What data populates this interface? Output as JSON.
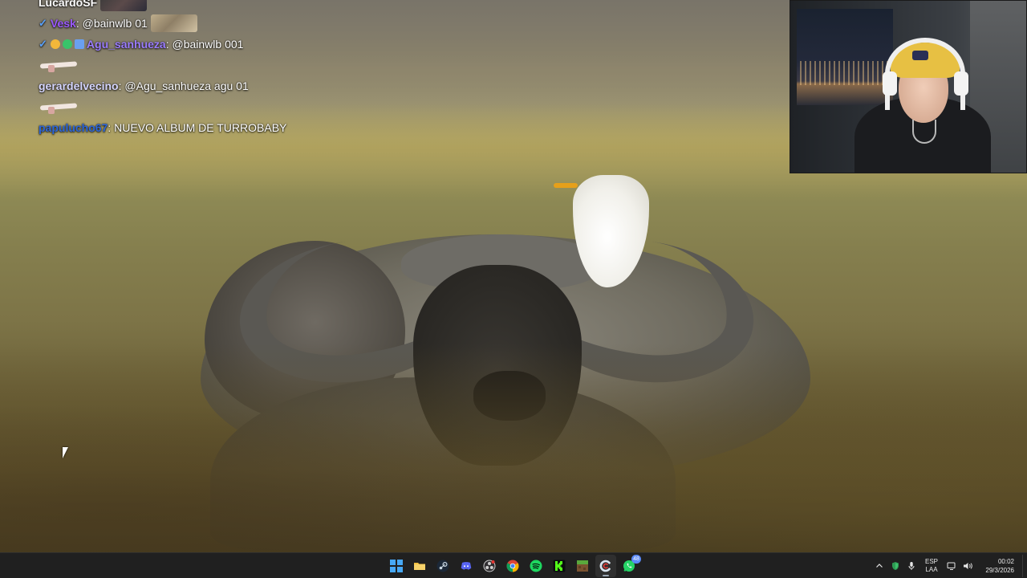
{
  "chat": {
    "messages": [
      {
        "user": "LucardoSF",
        "text": "",
        "user_color": "#ffffff",
        "has_emote": true
      },
      {
        "user": "Vesk",
        "text": ": @bainwlb 01",
        "user_color": "#9b59ff",
        "has_emote": true
      },
      {
        "user": "Agu_sanhueza",
        "text": ": @bainwlb 001",
        "user_color": "#9b7dff",
        "has_emote": false
      },
      {
        "user": "gerardelvecino",
        "text": ": @Agu_sanhueza agu 01",
        "user_color": "#d6d6ff",
        "has_emote": false
      },
      {
        "user": "papulucho67",
        "text": ": NUEVO ALBUM DE TURROBABY",
        "user_color": "#2c66d9",
        "has_emote": false
      }
    ]
  },
  "colors": {
    "taskbar_bg": "#202020",
    "accent": "#47a8f5"
  },
  "taskbar": {
    "apps": [
      {
        "name": "start",
        "icon": "windows-logo-icon"
      },
      {
        "name": "file-explorer",
        "icon": "folder-icon"
      },
      {
        "name": "steam",
        "icon": "steam-icon"
      },
      {
        "name": "discord",
        "icon": "discord-icon"
      },
      {
        "name": "obs",
        "icon": "obs-icon"
      },
      {
        "name": "chrome",
        "icon": "chrome-icon"
      },
      {
        "name": "spotify",
        "icon": "spotify-icon"
      },
      {
        "name": "kick",
        "icon": "kick-icon"
      },
      {
        "name": "minecraft",
        "icon": "minecraft-icon"
      },
      {
        "name": "ccleaner",
        "icon": "ccleaner-icon"
      },
      {
        "name": "whatsapp",
        "icon": "whatsapp-icon",
        "badge": "48"
      }
    ],
    "tray": {
      "language_top": "ESP",
      "language_bottom": "LAA",
      "time": "00:02",
      "date": "29/3/2026"
    }
  }
}
